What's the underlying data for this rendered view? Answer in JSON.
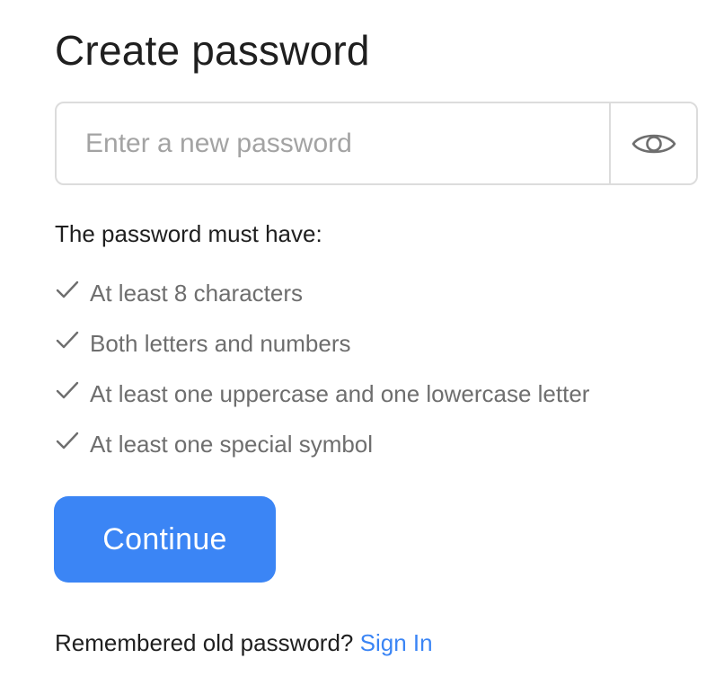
{
  "title": "Create password",
  "password_field": {
    "placeholder": "Enter a new password",
    "value": "",
    "toggle_icon": "eye-icon"
  },
  "requirements": {
    "heading": "The password must have:",
    "items": [
      {
        "label": "At least 8 characters",
        "icon": "check-icon"
      },
      {
        "label": "Both letters and numbers",
        "icon": "check-icon"
      },
      {
        "label": "At least one uppercase and one lowercase letter",
        "icon": "check-icon"
      },
      {
        "label": "At least one special symbol",
        "icon": "check-icon"
      }
    ]
  },
  "continue_button": {
    "label": "Continue"
  },
  "footer": {
    "text": "Remembered old password?",
    "link_label": "Sign In"
  },
  "colors": {
    "accent": "#3b85f5",
    "text_primary": "#1f1f1f",
    "text_secondary": "#6e6e6e",
    "border": "#dcdcdc",
    "placeholder": "#a3a3a3"
  }
}
